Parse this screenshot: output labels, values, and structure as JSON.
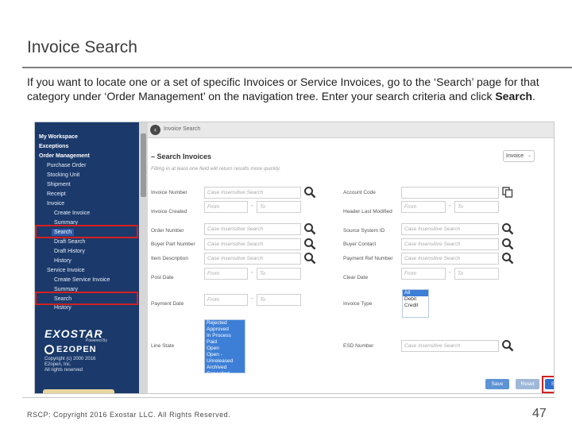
{
  "slide": {
    "title": "Invoice Search",
    "desc_text": "If you want to locate one or a set of specific Invoices or Service Invoices, go to the ‘Search’ page for that category under ‘Order Management’ on the navigation tree.  Enter your search criteria and click ",
    "desc_bold": "Search",
    "desc_end": ".",
    "footer": "RSCP:  Copyright 2016 Exostar LLC. All Rights Reserved.",
    "page_number": "47"
  },
  "nav": {
    "items": [
      {
        "label": "My Workspace"
      },
      {
        "label": "Exceptions"
      },
      {
        "label": "Order Management"
      },
      {
        "label": "Purchase Order"
      },
      {
        "label": "Stocking Unit"
      },
      {
        "label": "Shipment"
      },
      {
        "label": "Receipt"
      },
      {
        "label": "Invoice"
      },
      {
        "label": "Create Invoice"
      },
      {
        "label": "Summary"
      },
      {
        "label": "Search"
      },
      {
        "label": "Draft Search"
      },
      {
        "label": "Draft History"
      },
      {
        "label": "History"
      },
      {
        "label": "Service Invoice"
      },
      {
        "label": "Create Service Invoice"
      },
      {
        "label": "Summary"
      },
      {
        "label": "Search"
      },
      {
        "label": "History"
      }
    ],
    "logo_exostar": "EXOSTAR",
    "logo_powered": "Powered By",
    "logo_e2open": "E2OPEN",
    "copyright_lines": [
      "Copyright (c) 2000 2016",
      "E2open, Inc.",
      "All rights reserved"
    ]
  },
  "page": {
    "topbar_title": "Invoice Search",
    "section_title": "– Search Invoices",
    "hint": "Filling in at least one field will return results more quickly.",
    "type_select_value": "Invoice"
  },
  "form": {
    "placeholder_case": "Case Insensitive Search",
    "placeholder_from": "From",
    "placeholder_to": "To",
    "labels": {
      "invoice_number": "Invoice Number",
      "invoice_created": "Invoice Created",
      "order_number": "Order Number",
      "buyer_part_number": "Buyer Part Number",
      "item_description": "Item Description",
      "post_date": "Post Date",
      "payment_date": "Payment Date",
      "line_state": "Line State",
      "account_code": "Account Code",
      "header_last_modified": "Header Last Modified",
      "source_system_id": "Source System ID",
      "buyer_contact": "Buyer Contact",
      "payment_ref_number": "Payment Ref Number",
      "clear_date": "Clear Date",
      "invoice_type": "Invoice Type",
      "esd_number": "ESD Number"
    },
    "invoice_type_options": [
      "All",
      "Debit",
      "Credit"
    ],
    "line_state_options": [
      "Rejected",
      "Approved",
      "In Process",
      "Paid",
      "Open",
      "Open - Unreleased",
      "Archived",
      "Cancelled"
    ],
    "buttons": {
      "save": "Save",
      "reset": "Reset",
      "search": "Search"
    }
  },
  "colors": {
    "nav_bg": "#1b3a6b",
    "highlight_red": "#d42020",
    "button_blue": "#2f6fcc"
  }
}
